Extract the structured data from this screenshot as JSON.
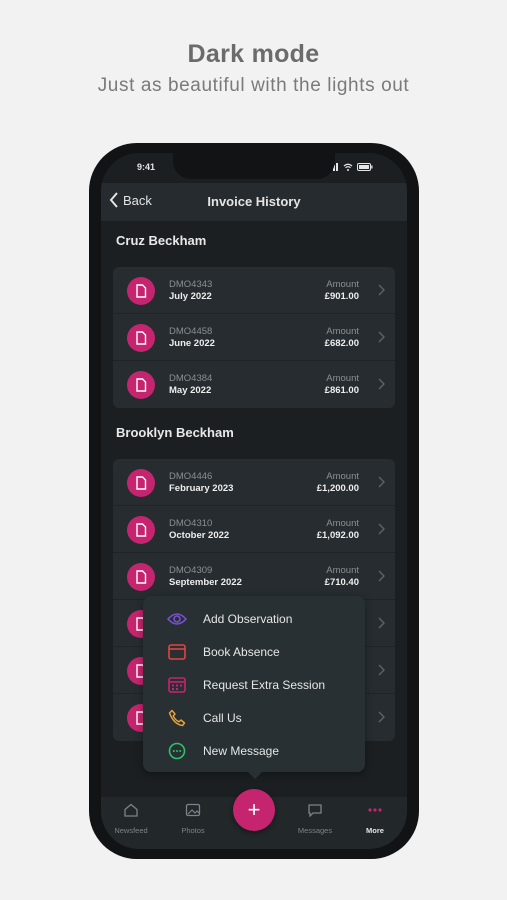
{
  "promo": {
    "title": "Dark mode",
    "subtitle": "Just as beautiful with the lights out"
  },
  "status": {
    "time": "9:41"
  },
  "nav": {
    "back_label": "Back",
    "title": "Invoice History"
  },
  "sections": [
    {
      "name": "Cruz Beckham",
      "invoices": [
        {
          "id": "DMO4343",
          "period": "July 2022",
          "amount_label": "Amount",
          "amount": "£901.00"
        },
        {
          "id": "DMO4458",
          "period": "June 2022",
          "amount_label": "Amount",
          "amount": "£682.00"
        },
        {
          "id": "DMO4384",
          "period": "May 2022",
          "amount_label": "Amount",
          "amount": "£861.00"
        }
      ]
    },
    {
      "name": "Brooklyn Beckham",
      "invoices": [
        {
          "id": "DMO4446",
          "period": "February 2023",
          "amount_label": "Amount",
          "amount": "£1,200.00"
        },
        {
          "id": "DMO4310",
          "period": "October 2022",
          "amount_label": "Amount",
          "amount": "£1,092.00"
        },
        {
          "id": "DMO4309",
          "period": "September 2022",
          "amount_label": "Amount",
          "amount": "£710.40"
        }
      ]
    }
  ],
  "menu": {
    "items": [
      {
        "label": "Add Observation",
        "icon": "eye-icon",
        "color": "#7b4fd6"
      },
      {
        "label": "Book Absence",
        "icon": "calendar-icon",
        "color": "#e0453f"
      },
      {
        "label": "Request Extra Session",
        "icon": "calendar-grid-icon",
        "color": "#c5246f"
      },
      {
        "label": "Call Us",
        "icon": "phone-icon",
        "color": "#e6a23c"
      },
      {
        "label": "New Message",
        "icon": "chat-bubble-icon",
        "color": "#2ec26a"
      }
    ]
  },
  "tabbar": {
    "items": [
      {
        "label": "Newsfeed",
        "icon": "home-icon"
      },
      {
        "label": "Photos",
        "icon": "photo-icon"
      },
      {
        "label": "Messages",
        "icon": "message-icon"
      },
      {
        "label": "More",
        "icon": "more-dots-icon",
        "active": true
      }
    ],
    "fab_label": "+"
  },
  "colors": {
    "accent": "#c5246f",
    "background": "#1b1f22",
    "card": "#262c30"
  }
}
